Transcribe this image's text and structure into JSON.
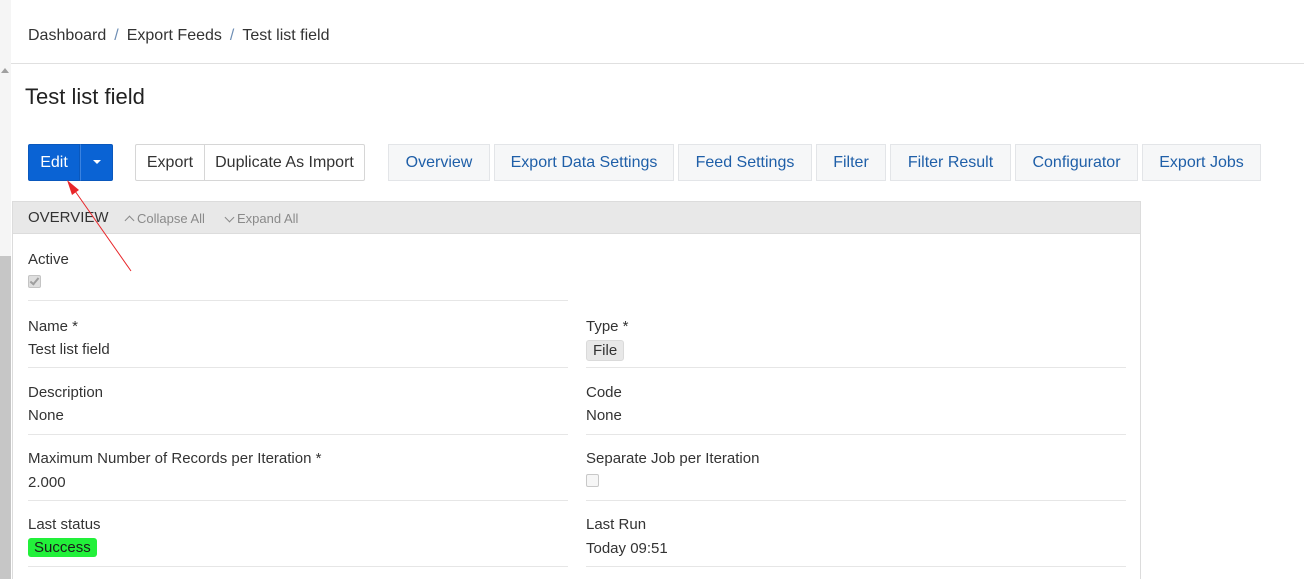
{
  "breadcrumb": {
    "items": [
      "Dashboard",
      "Export Feeds",
      "Test list field"
    ],
    "separator": "/"
  },
  "page_title": "Test list field",
  "toolbar": {
    "edit_label": "Edit",
    "dropdown_icon": "caret-down-icon",
    "export_label": "Export",
    "duplicate_label": "Duplicate As Import"
  },
  "tabs": [
    "Overview",
    "Export Data Settings",
    "Feed Settings",
    "Filter",
    "Filter Result",
    "Configurator",
    "Export Jobs"
  ],
  "panel": {
    "title": "OVERVIEW",
    "collapse_all": "Collapse All",
    "expand_all": "Expand All"
  },
  "fields": {
    "active": {
      "label": "Active",
      "checked": true
    },
    "name": {
      "label": "Name *",
      "value": "Test list field"
    },
    "type": {
      "label": "Type *",
      "value": "File"
    },
    "description": {
      "label": "Description",
      "value": "None"
    },
    "code": {
      "label": "Code",
      "value": "None"
    },
    "max_records": {
      "label": "Maximum Number of Records per Iteration *",
      "value": "2.000"
    },
    "separate_job": {
      "label": "Separate Job per Iteration",
      "checked": false
    },
    "last_status": {
      "label": "Last status",
      "value": "Success"
    },
    "last_run": {
      "label": "Last Run",
      "value": "Today 09:51"
    }
  },
  "colors": {
    "primary": "#0a63d4",
    "tab_text": "#1f5fa8",
    "success": "#22f03a",
    "annotation_arrow": "#e8262a"
  }
}
